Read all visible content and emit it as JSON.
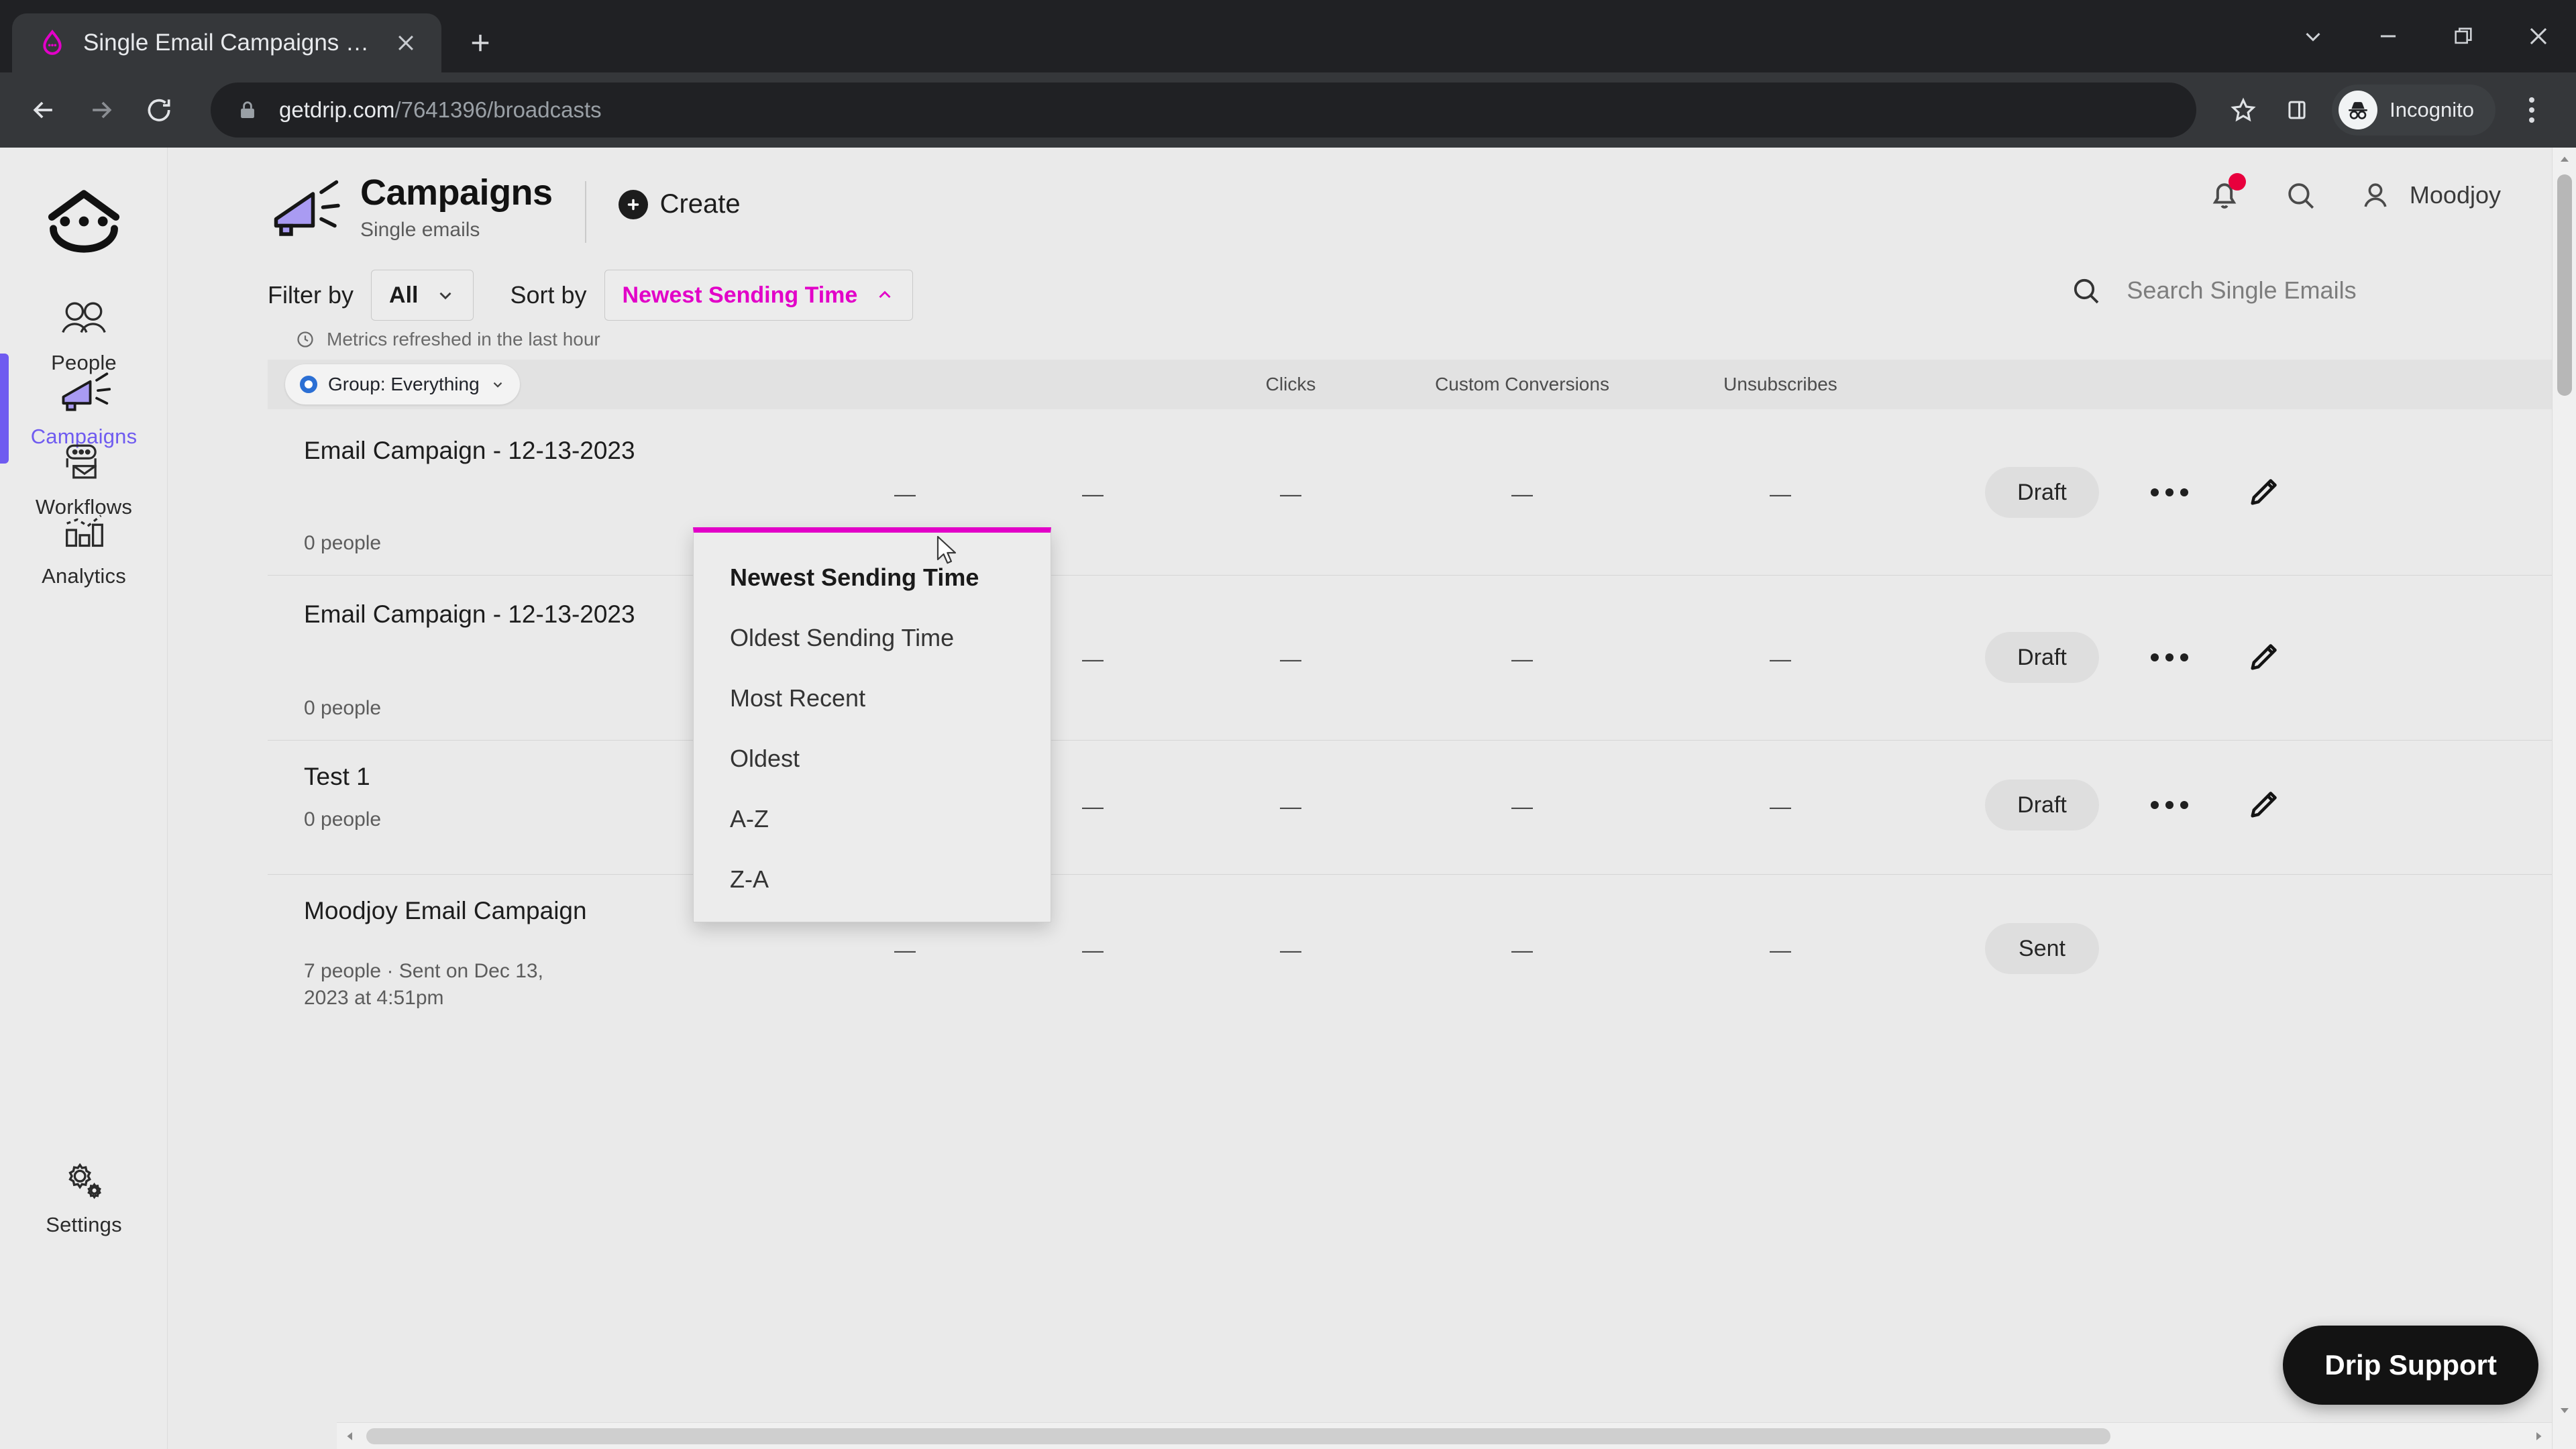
{
  "browser": {
    "tab": {
      "title": "Single Email Campaigns · Drip",
      "favicon_icon": "drip-favicon",
      "close_icon": "close-icon"
    },
    "new_tab_icon": "plus-icon",
    "window_controls": [
      {
        "name": "tab-search-button",
        "icon": "chevron-down-icon"
      },
      {
        "name": "minimize-button",
        "icon": "minimize-icon"
      },
      {
        "name": "maximize-button",
        "icon": "restore-icon"
      },
      {
        "name": "close-window-button",
        "icon": "close-icon"
      }
    ],
    "nav": {
      "back_icon": "arrow-left-icon",
      "forward_icon": "arrow-right-icon",
      "reload_icon": "reload-icon"
    },
    "url": {
      "lock_icon": "lock-icon",
      "host": "getdrip.com",
      "path": "/7641396/broadcasts"
    },
    "omnibox_actions": [
      {
        "name": "bookmark-button",
        "icon": "star-icon"
      },
      {
        "name": "side-panel-button",
        "icon": "side-panel-icon"
      }
    ],
    "profile": {
      "label": "Incognito",
      "icon": "incognito-icon"
    },
    "menu_icon": "kebab-menu-icon"
  },
  "sidebar": {
    "logo_icon": "drip-logo-icon",
    "items": [
      {
        "label": "People",
        "icon": "people-icon",
        "active": false
      },
      {
        "label": "Campaigns",
        "icon": "megaphone-icon",
        "active": true
      },
      {
        "label": "Workflows",
        "icon": "workflow-icon",
        "active": false
      },
      {
        "label": "Analytics",
        "icon": "analytics-icon",
        "active": false
      },
      {
        "label": "Settings",
        "icon": "gear-icon",
        "active": false
      }
    ],
    "accent_color": "#6f5bf0"
  },
  "header": {
    "icon": "megaphone-icon",
    "title": "Campaigns",
    "subtitle": "Single emails",
    "create_label": "Create",
    "create_icon": "plus-circle-icon",
    "notifications_icon": "bell-icon",
    "notification_badge_color": "#e8003d",
    "search_icon": "search-icon",
    "account_icon": "person-icon",
    "account_name": "Moodjoy"
  },
  "filters": {
    "filter_label": "Filter by",
    "filter_value": "All",
    "sort_label": "Sort by",
    "sort_value": "Newest Sending Time",
    "sort_accent_color": "#e200c8",
    "metrics_note": "Metrics refreshed in the last hour",
    "metrics_icon": "clock-icon",
    "chevron_down_icon": "chevron-down-icon",
    "chevron_up_icon": "chevron-up-icon"
  },
  "sort_dropdown": {
    "open": true,
    "options": [
      {
        "label": "Newest Sending Time",
        "selected": true
      },
      {
        "label": "Oldest Sending Time",
        "selected": false
      },
      {
        "label": "Most Recent",
        "selected": false
      },
      {
        "label": "Oldest",
        "selected": false
      },
      {
        "label": "A-Z",
        "selected": false
      },
      {
        "label": "Z-A",
        "selected": false
      }
    ]
  },
  "search": {
    "placeholder": "Search Single Emails",
    "value": "",
    "icon": "search-icon"
  },
  "table": {
    "group_chip": {
      "label": "Group: Everything",
      "icon": "group-circle-icon",
      "chevron_icon": "chevron-down-icon"
    },
    "columns": [
      "",
      "",
      "Clicks",
      "Custom Conversions",
      "Unsubscribes"
    ],
    "rows": [
      {
        "name": "Email Campaign - 12-13-2023",
        "meta": "0 people",
        "values": [
          "—",
          "—",
          "—",
          "—",
          "—"
        ],
        "status": "Draft",
        "more_icon": "more-horizontal-icon",
        "edit_icon": "pencil-icon"
      },
      {
        "name": "Email Campaign - 12-13-2023",
        "meta": "0 people",
        "values": [
          "—",
          "—",
          "—",
          "—",
          "—"
        ],
        "status": "Draft",
        "more_icon": "more-horizontal-icon",
        "edit_icon": "pencil-icon"
      },
      {
        "name": "Test 1",
        "meta": "0 people",
        "values": [
          "—",
          "—",
          "—",
          "—",
          "—"
        ],
        "status": "Draft",
        "more_icon": "more-horizontal-icon",
        "edit_icon": "pencil-icon"
      },
      {
        "name": "Moodjoy Email Campaign",
        "meta": "7 people · Sent on Dec 13, 2023 at 4:51pm",
        "values": [
          "—",
          "—",
          "—",
          "—",
          "—"
        ],
        "status": "Sent",
        "more_icon": "more-horizontal-icon",
        "edit_icon": "pencil-icon"
      }
    ]
  },
  "support": {
    "label": "Drip Support"
  },
  "scrollbars": {
    "vertical": {
      "up_icon": "triangle-up-icon",
      "down_icon": "triangle-down-icon"
    },
    "horizontal": {
      "left_icon": "triangle-left-icon",
      "right_icon": "triangle-right-icon"
    }
  }
}
